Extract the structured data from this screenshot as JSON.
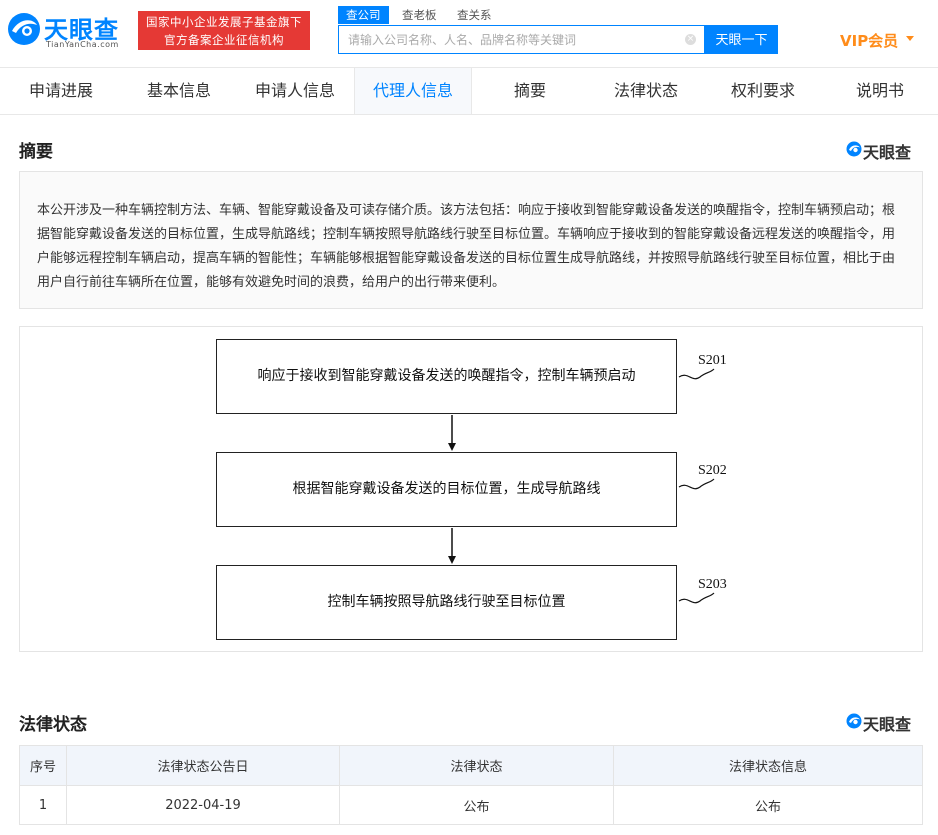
{
  "header": {
    "logo_text": "天眼查",
    "logo_sub": "TianYanCha.com",
    "gov_badge_line1": "国家中小企业发展子基金旗下",
    "gov_badge_line2": "官方备案企业征信机构",
    "search_tabs": [
      "查公司",
      "查老板",
      "查关系"
    ],
    "search_placeholder": "请输入公司名称、人名、品牌名称等关键词",
    "search_button": "天眼一下",
    "vip_label": "VIP会员"
  },
  "nav": {
    "tabs": [
      "申请进展",
      "基本信息",
      "申请人信息",
      "代理人信息",
      "摘要",
      "法律状态",
      "权利要求",
      "说明书"
    ],
    "active_index": 3
  },
  "abstract": {
    "title": "摘要",
    "brand": "天眼查",
    "text": "本公开涉及一种车辆控制方法、车辆、智能穿戴设备及可读存储介质。该方法包括：响应于接收到智能穿戴设备发送的唤醒指令，控制车辆预启动；根据智能穿戴设备发送的目标位置，生成导航路线；控制车辆按照导航路线行驶至目标位置。车辆响应于接收到的智能穿戴设备远程发送的唤醒指令，用户能够远程控制车辆启动，提高车辆的智能性；车辆能够根据智能穿戴设备发送的目标位置生成导航路线，并按照导航路线行驶至目标位置，相比于由用户自行前往车辆所在位置，能够有效避免时间的浪费，给用户的出行带来便利。"
  },
  "figure": {
    "steps": [
      {
        "label": "S201",
        "text": "响应于接收到智能穿戴设备发送的唤醒指令，控制车辆预启动"
      },
      {
        "label": "S202",
        "text": "根据智能穿戴设备发送的目标位置，生成导航路线"
      },
      {
        "label": "S203",
        "text": "控制车辆按照导航路线行驶至目标位置"
      }
    ]
  },
  "legal": {
    "title": "法律状态",
    "brand": "天眼查",
    "columns": [
      "序号",
      "法律状态公告日",
      "法律状态",
      "法律状态信息"
    ],
    "rows": [
      [
        "1",
        "2022-04-19",
        "公布",
        "公布"
      ]
    ]
  },
  "colors": {
    "brand_blue": "#0084ff",
    "badge_red": "#e53935",
    "vip_orange": "#ff8c1a"
  }
}
